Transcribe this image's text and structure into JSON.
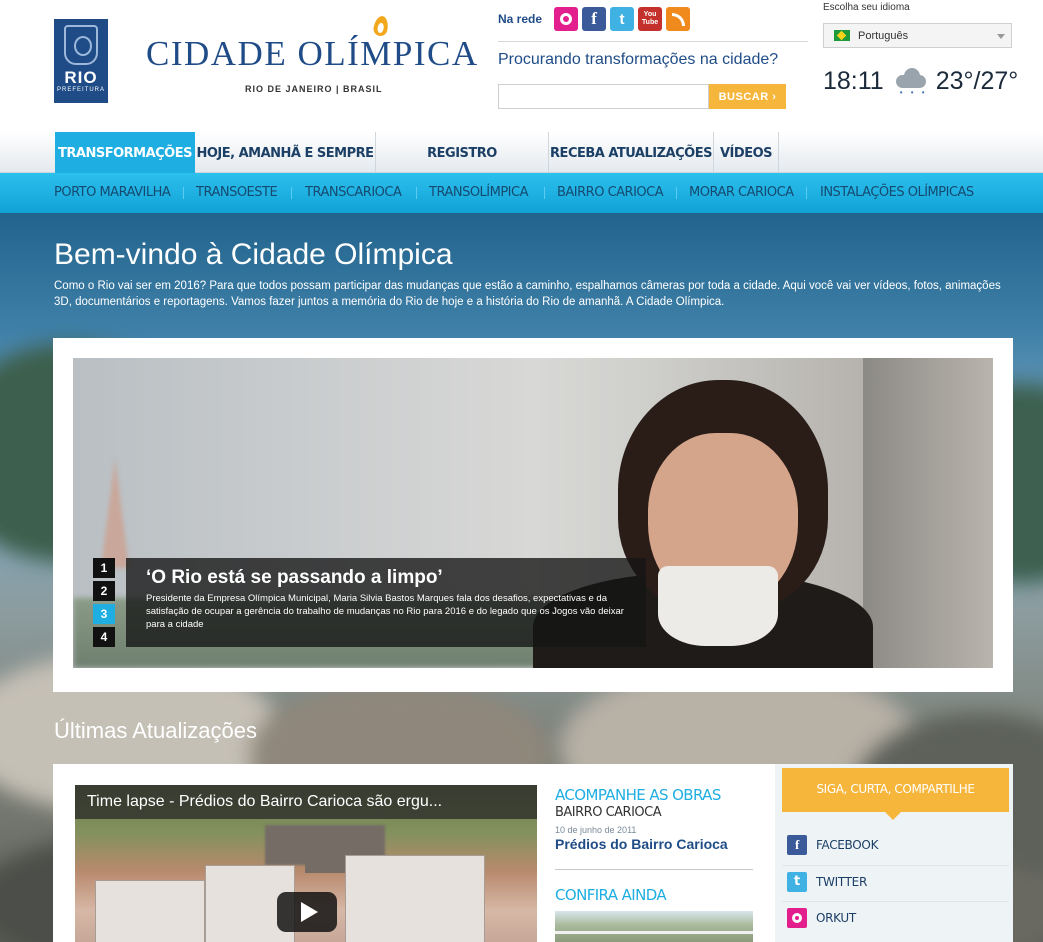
{
  "brand": {
    "logo_text": "RIO",
    "logo_subtext": "PREFEITURA",
    "title": "CIDADE OLÍMPICA",
    "subtitle": "RIO DE JANEIRO | BRASIL"
  },
  "social": {
    "label": "Na rede",
    "icons": [
      "orkut-icon",
      "facebook-icon",
      "twitter-icon",
      "youtube-icon",
      "rss-icon"
    ],
    "facebook_glyph": "f",
    "twitter_glyph": "t",
    "youtube_glyph_top": "You",
    "youtube_glyph_bottom": "Tube"
  },
  "search": {
    "heading": "Procurando transformações na cidade?",
    "value": "",
    "placeholder": "",
    "button_label": "BUSCAR ›"
  },
  "language": {
    "label": "Escolha seu idioma",
    "selected": "Português"
  },
  "weather": {
    "time": "18:11",
    "temperature": "23°/27°",
    "icon": "rain-cloud-icon"
  },
  "nav_primary": [
    {
      "label": "TRANSFORMAÇÕES",
      "active": true
    },
    {
      "label": "HOJE, AMANHÃ E SEMPRE",
      "active": false
    },
    {
      "label": "REGISTRO FOTOGRÁFICO",
      "active": false
    },
    {
      "label": "RECEBA ATUALIZAÇÕES",
      "active": false
    },
    {
      "label": "VÍDEOS",
      "active": false
    }
  ],
  "nav_secondary": [
    {
      "label": "PORTO MARAVILHA"
    },
    {
      "label": "TRANSOESTE"
    },
    {
      "label": "TRANSCARIOCA"
    },
    {
      "label": "TRANSOLÍMPICA"
    },
    {
      "label": "BAIRRO CARIOCA"
    },
    {
      "label": "MORAR CARIOCA"
    },
    {
      "label": "INSTALAÇÕES OLÍMPICAS"
    }
  ],
  "welcome": {
    "title": "Bem-vindo à Cidade Olímpica",
    "text": "Como o Rio vai ser em 2016? Para que todos possam participar das mudanças que estão a caminho, espalhamos câmeras por toda a cidade. Aqui você vai ver vídeos, fotos, animações 3D, documentários e reportagens. Vamos fazer juntos a memória do Rio de hoje e a história do Rio de amanhã. A Cidade Olímpica."
  },
  "feature": {
    "title": "‘O Rio está se passando a limpo’",
    "text": "Presidente da Empresa Olímpica Municipal, Maria Silvia Bastos Marques fala dos desafios, expectativas e da satisfação de ocupar a gerência do trabalho de mudanças no Rio para 2016 e do legado que os Jogos vão deixar para a cidade",
    "slides": [
      "1",
      "2",
      "3",
      "4"
    ],
    "active_slide": "3"
  },
  "updates": {
    "title": "Últimas Atualizações",
    "video_title": "Time lapse - Prédios do Bairro Carioca são ergu...",
    "accompany_heading": "ACOMPANHE AS OBRAS",
    "accompany_sub": "BAIRRO CARIOCA",
    "accompany_date": "10 de junho de 2011",
    "accompany_link": "Prédios do Bairro Carioca",
    "see_also_heading": "CONFIRA AINDA"
  },
  "share": {
    "heading": "SIGA, CURTA, COMPARTILHE",
    "items": [
      {
        "label": "FACEBOOK",
        "icon": "facebook-icon",
        "glyph": "f"
      },
      {
        "label": "TWITTER",
        "icon": "twitter-icon",
        "glyph": "t"
      },
      {
        "label": "ORKUT",
        "icon": "orkut-icon",
        "glyph": ""
      }
    ]
  },
  "colors": {
    "brand_blue": "#1f4c87",
    "accent_cyan": "#1eaee2",
    "accent_orange": "#f6b63b"
  }
}
